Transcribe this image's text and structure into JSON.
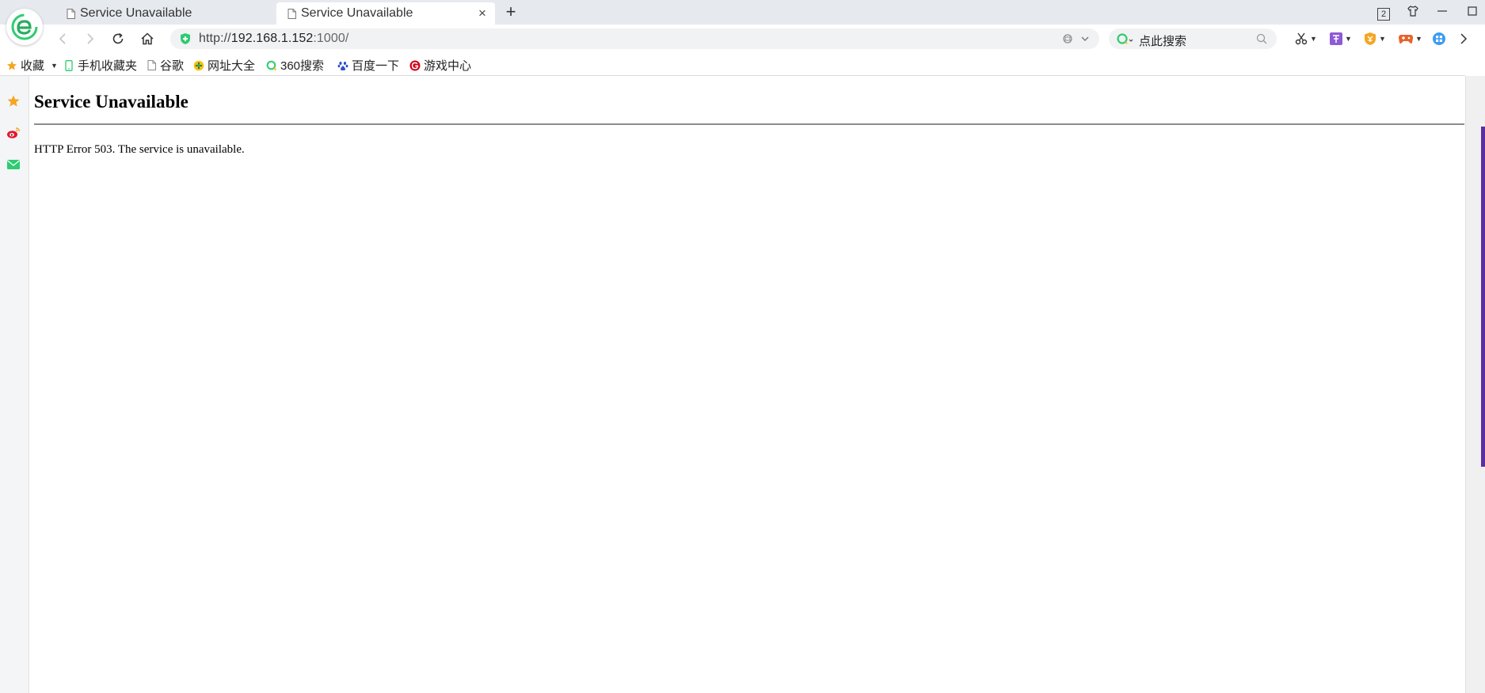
{
  "tabs": [
    {
      "title": "Service Unavailable",
      "active": false
    },
    {
      "title": "Service Unavailable",
      "active": true
    }
  ],
  "window": {
    "tab_count": "2"
  },
  "address_bar": {
    "scheme": "http://",
    "host": "192.168.1.152",
    "port_path": ":1000/"
  },
  "search": {
    "placeholder": "点此搜索"
  },
  "bookmarks": [
    {
      "label": "收藏",
      "icon": "star-icon"
    },
    {
      "label": "手机收藏夹",
      "icon": "phone-icon"
    },
    {
      "label": "谷歌",
      "icon": "page-icon"
    },
    {
      "label": "网址大全",
      "icon": "globe-icon"
    },
    {
      "label": "360搜索",
      "icon": "360-search-icon"
    },
    {
      "label": "百度一下",
      "icon": "baidu-paw-icon"
    },
    {
      "label": "游戏中心",
      "icon": "game-center-icon"
    }
  ],
  "page": {
    "heading": "Service Unavailable",
    "message": "HTTP Error 503. The service is unavailable."
  },
  "colors": {
    "brand_green": "#2ecc71",
    "tab_strip": "#e6e9ee",
    "scroll_accent": "#5b2fa0"
  }
}
